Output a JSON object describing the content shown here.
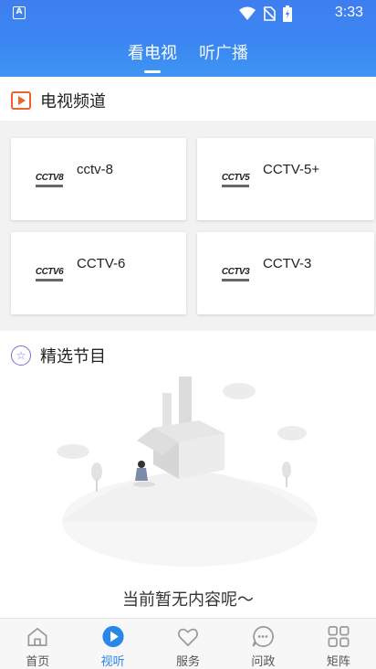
{
  "status": {
    "time": "3:33",
    "app_icon": "A"
  },
  "header": {
    "tabs": [
      {
        "label": "看电视",
        "active": true
      },
      {
        "label": "听广播",
        "active": false
      }
    ]
  },
  "tv_section": {
    "title": "电视频道",
    "channels": [
      {
        "name": "cctv-8",
        "logo": "CCTV8"
      },
      {
        "name": "CCTV-5+",
        "logo": "CCTV5"
      },
      {
        "name": "CCTV-6",
        "logo": "CCTV6"
      },
      {
        "name": "CCTV-3",
        "logo": "CCTV3"
      }
    ]
  },
  "featured_section": {
    "title": "精选节目",
    "empty_text": "当前暂无内容呢～"
  },
  "bottom_nav": {
    "items": [
      {
        "label": "首页",
        "icon": "home-icon",
        "active": false
      },
      {
        "label": "视听",
        "icon": "play-icon",
        "active": true
      },
      {
        "label": "服务",
        "icon": "heart-icon",
        "active": false
      },
      {
        "label": "问政",
        "icon": "chat-icon",
        "active": false
      },
      {
        "label": "矩阵",
        "icon": "grid-icon",
        "active": false
      }
    ]
  },
  "colors": {
    "accent": "#2a87ea",
    "header": "#3b86f2",
    "tv_icon": "#f0612b",
    "star_icon": "#7b6bd6"
  }
}
